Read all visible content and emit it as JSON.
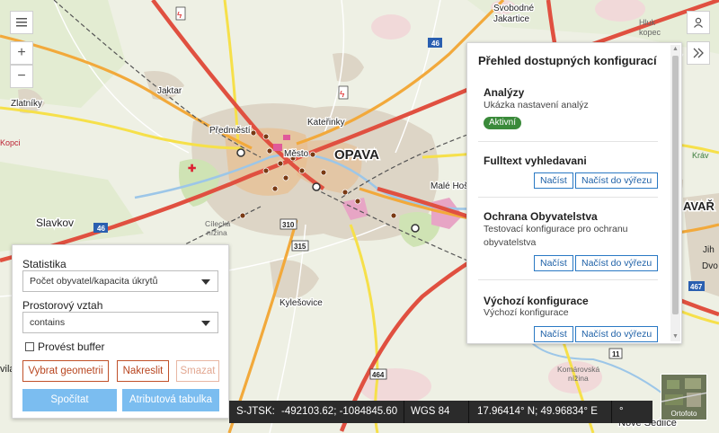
{
  "map": {
    "labels": {
      "opava": "OPAVA",
      "jaktar": "Jaktar",
      "predmesti": "Předměstí",
      "mesto": "Město",
      "katerinky": "Kateřinky",
      "zlatniky": "Zlatníky",
      "slavkov": "Slavkov",
      "kylesovice": "Kylešovice",
      "male_hoste": "Malé Hoš",
      "svobodna": "Svobodné",
      "jakartice": "Jakartice",
      "hluk": "Hluk",
      "kopec": "kopec",
      "komarovska": "Komárovská",
      "nizina": "nížina",
      "cilecka": "Cílecká",
      "nove_sedlice": "Nové Sedlice",
      "kopci": "Kopci",
      "krav": "Kráv",
      "avar": "AVAŘ",
      "dvo": "Dvo",
      "jih": "Jih",
      "route_46": "46",
      "route_46b": "46",
      "route_310": "310",
      "route_315": "315",
      "route_464": "464",
      "route_11": "11",
      "route_467": "467",
      "vila": "vila",
      "nizina2": "nížina"
    }
  },
  "controls": {
    "menu_icon": "hamburger-icon",
    "zoom_in": "+",
    "zoom_out": "−",
    "user_icon": "user-icon",
    "expand_icon": "double-chevron-right-icon"
  },
  "config_panel": {
    "title": "Přehled dostupných konfigurací",
    "items": [
      {
        "title": "Analýzy",
        "description": "Ukázka nastavení analýz",
        "badge": "Aktivní"
      },
      {
        "title": "Fulltext vyhledavani",
        "load": "Načíst",
        "load_extent": "Načíst do výřezu"
      },
      {
        "title": "Ochrana Obyvatelstva",
        "description": "Testovací konfigurace pro ochranu obyvatelstva",
        "load": "Načíst",
        "load_extent": "Načíst do výřezu"
      },
      {
        "title": "Výchozí konfigurace",
        "description": "Výchozí konfigurace",
        "load": "Načíst",
        "load_extent": "Načíst do výřezu"
      }
    ]
  },
  "analysis_panel": {
    "statistika_label": "Statistika",
    "statistika_value": "Počet obyvatel/kapacita úkrytů",
    "vztah_label": "Prostorový vztah",
    "vztah_value": "contains",
    "buffer_label": "Provést buffer",
    "select_geometry": "Vybrat geometrii",
    "draw": "Nakreslit",
    "clear": "Smazat",
    "compute": "Spočítat",
    "attribute_table": "Atributová tabulka"
  },
  "coordinates": {
    "system1": "S-JTSK:",
    "value1": "-492103.62; -1084845.60",
    "system2": "WGS 84",
    "value2": "17.96414° N; 49.96834° E",
    "degree": "°"
  },
  "basemap_toggle": {
    "label": "Ortofoto"
  },
  "colors": {
    "road_major": "#e05040",
    "road_secondary": "#f2a93b",
    "road_yellow": "#f6e04a",
    "urban": "#d9d3c6",
    "green": "#cfe3b4",
    "water": "#9cc6e8",
    "accent_blue": "#2a79c4",
    "button_blue": "#7bbdf0",
    "active_green": "#3a8a3a",
    "orange_btn": "#c0512a"
  }
}
